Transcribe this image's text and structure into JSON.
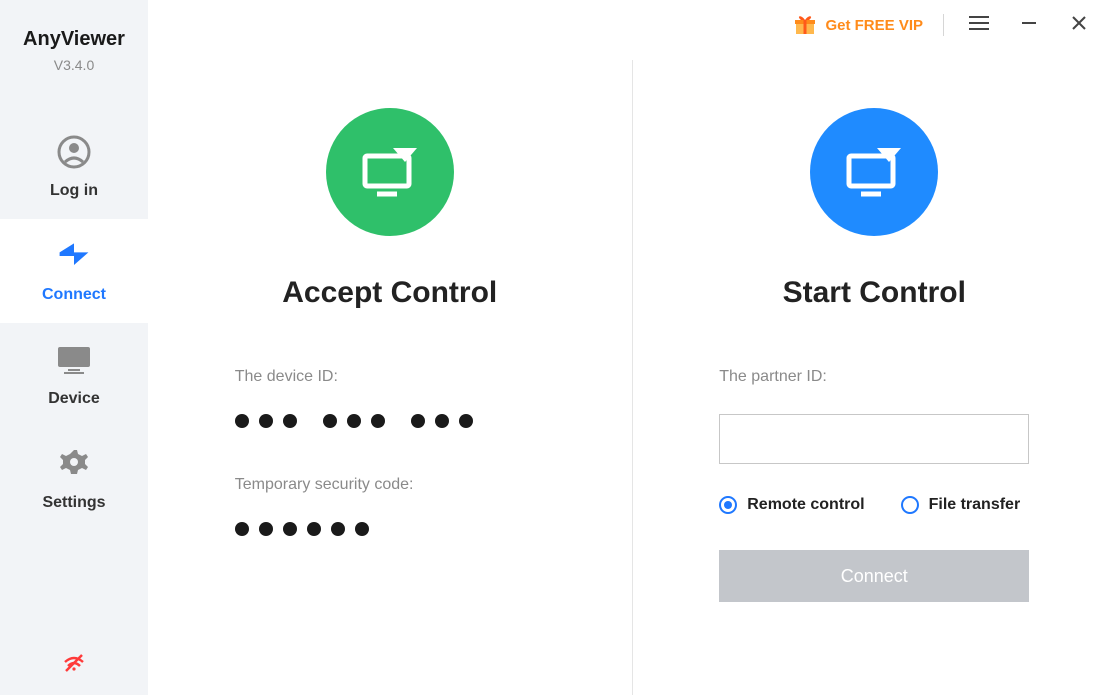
{
  "brand": {
    "name": "AnyViewer",
    "version": "V3.4.0"
  },
  "sidebar": {
    "items": [
      {
        "label": "Log in",
        "icon": "user-circle-icon",
        "active": false
      },
      {
        "label": "Connect",
        "icon": "connect-logo-icon",
        "active": true
      },
      {
        "label": "Device",
        "icon": "monitor-icon",
        "active": false
      },
      {
        "label": "Settings",
        "icon": "gear-icon",
        "active": false
      }
    ]
  },
  "topbar": {
    "vip_label": "Get FREE VIP"
  },
  "accept": {
    "title": "Accept Control",
    "device_id_label": "The device ID:",
    "device_id_mask": "••• ••• •••",
    "security_label": "Temporary security code:",
    "security_mask": "••••••"
  },
  "start": {
    "title": "Start Control",
    "partner_id_label": "The partner ID:",
    "partner_id_value": "",
    "mode": {
      "remote_label": "Remote control",
      "file_label": "File transfer",
      "selected": "remote"
    },
    "connect_label": "Connect"
  }
}
